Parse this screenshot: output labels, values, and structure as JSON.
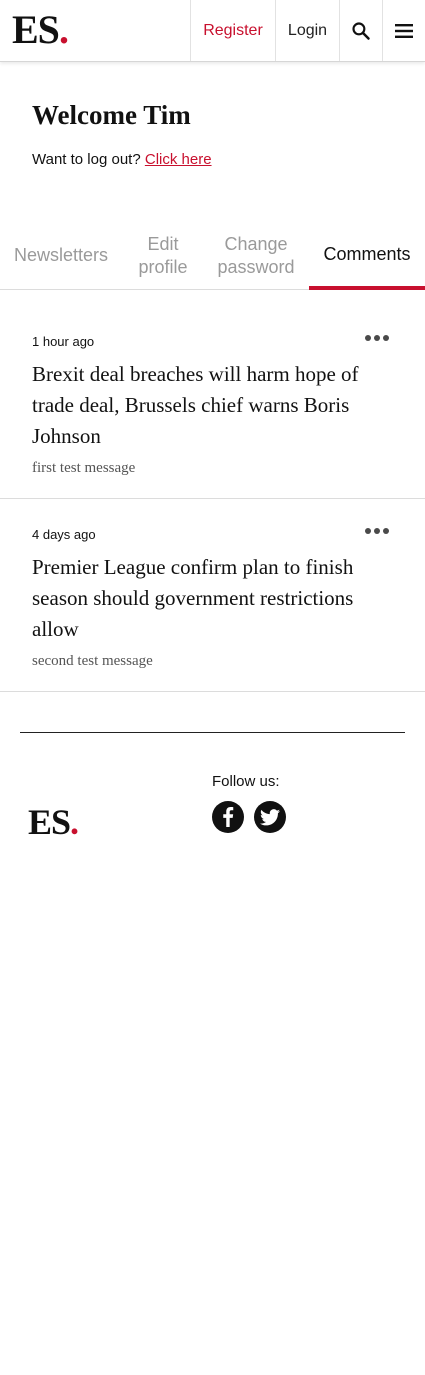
{
  "header": {
    "logo_text": "ES",
    "logo_dot": ".",
    "register_label": "Register",
    "login_label": "Login",
    "search_icon": "search-icon",
    "menu_icon": "hamburger-menu-icon"
  },
  "account": {
    "welcome_text": "Welcome Tim",
    "logout_prompt": "Want to log out?",
    "logout_link": "Click here"
  },
  "tabs": [
    {
      "label": "Newsletters",
      "active": false
    },
    {
      "label": "Edit profile",
      "active": false
    },
    {
      "label": "Change password",
      "active": false
    },
    {
      "label": "Comments",
      "active": true
    }
  ],
  "comments": [
    {
      "time": "1 hour ago",
      "title": "Brexit deal breaches will harm hope of trade deal, Brussels chief warns Boris Johnson",
      "message": "first test message"
    },
    {
      "time": "4 days ago",
      "title": "Premier League confirm plan to finish season should government restrictions allow",
      "message": "second test message"
    }
  ],
  "footer": {
    "logo_text": "ES",
    "logo_dot": ".",
    "follow_label": "Follow us:",
    "social": [
      {
        "icon": "facebook-icon"
      },
      {
        "icon": "twitter-icon"
      }
    ]
  },
  "colors": {
    "accent": "#c8102e",
    "text": "#111111",
    "muted_tab": "#9a9a9a"
  }
}
